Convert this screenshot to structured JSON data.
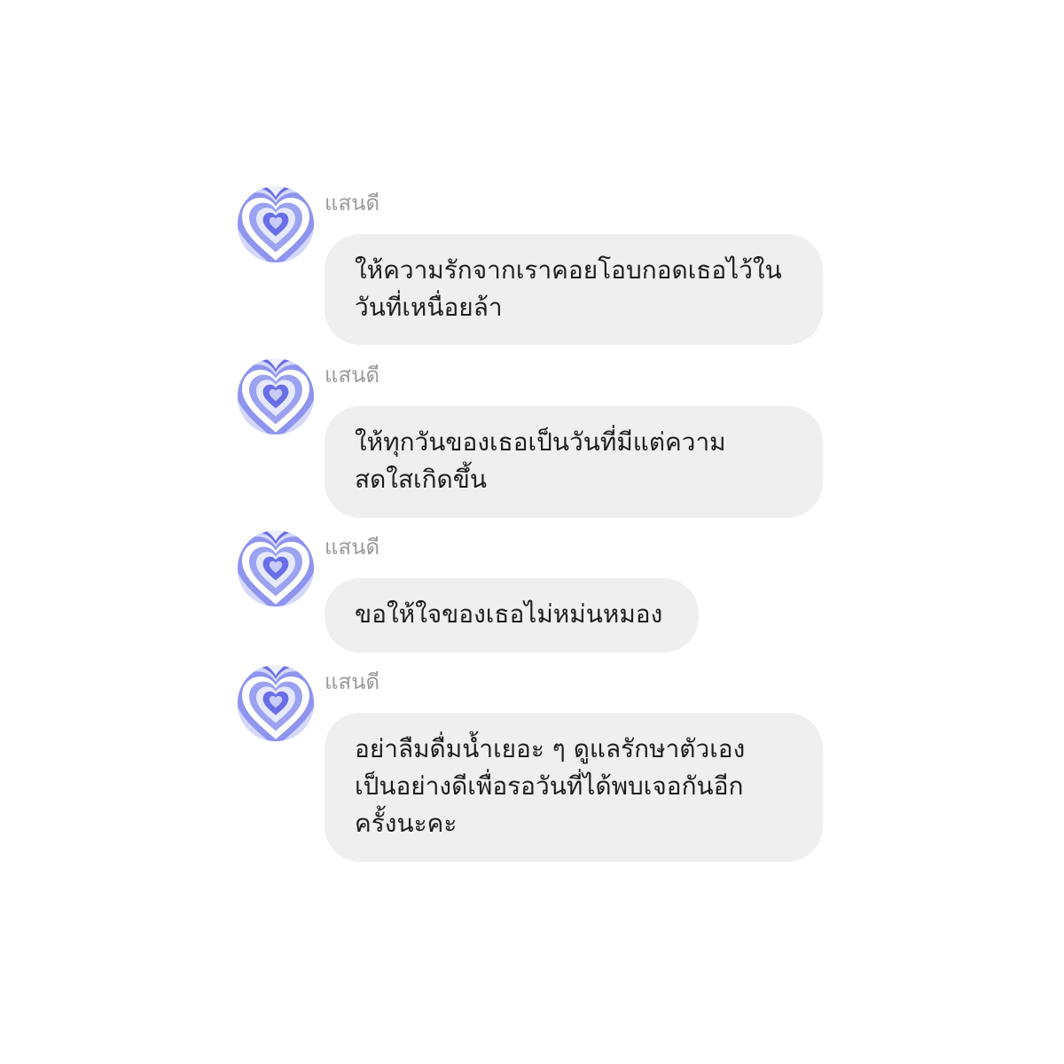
{
  "messages": [
    {
      "sender": "แสนดี",
      "avatar_icon": "heart-ripple-icon",
      "lines": [
        "ให้ความรักจากเราคอยโอบกอดเธอไว้ใน",
        "วันที่เหนื่อยล้า"
      ]
    },
    {
      "sender": "แสนดี",
      "avatar_icon": "heart-ripple-icon",
      "lines": [
        "ให้ทุกวันของเธอเป็นวันที่มีแต่ความ",
        "สดใสเกิดขึ้น"
      ]
    },
    {
      "sender": "แสนดี",
      "avatar_icon": "heart-ripple-icon",
      "lines": [
        "ขอให้ใจของเธอไม่หม่นหมอง"
      ]
    },
    {
      "sender": "แสนดี",
      "avatar_icon": "heart-ripple-icon",
      "lines": [
        "อย่าลืมดื่มน้ำเยอะ ๆ ดูแลรักษาตัวเอง",
        "เป็นอย่างดีเพื่อรอวันที่ได้พบเจอกันอีก",
        "ครั้งนะคะ"
      ]
    }
  ],
  "colors": {
    "page_background": "#ffffff",
    "bubble_background": "#efefef",
    "message_text": "#1e1e1e",
    "sender_text": "#9a9a9a",
    "heart_dark": "#6a6ee6",
    "heart_mid": "#9da2f0",
    "heart_light": "#d5d8fb"
  }
}
